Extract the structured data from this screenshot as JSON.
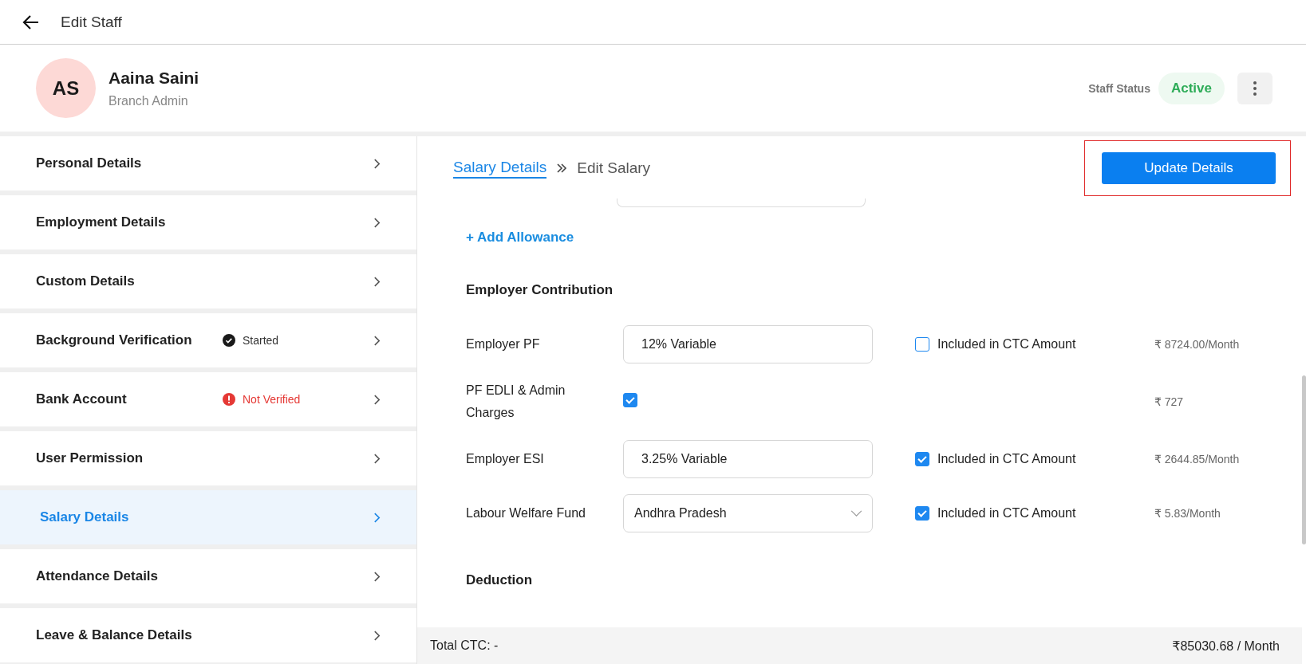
{
  "header": {
    "title": "Edit Staff"
  },
  "profile": {
    "initials": "AS",
    "name": "Aaina Saini",
    "role": "Branch Admin",
    "status_label": "Staff Status",
    "status": "Active"
  },
  "sidebar": {
    "items": [
      {
        "label": "Personal Details",
        "selected": false
      },
      {
        "label": "Employment Details",
        "selected": false
      },
      {
        "label": "Custom Details",
        "selected": false
      },
      {
        "label": "Background Verification",
        "selected": false,
        "badge": {
          "kind": "started",
          "text": "Started"
        }
      },
      {
        "label": "Bank Account",
        "selected": false,
        "badge": {
          "kind": "not_verified",
          "text": "Not Verified"
        }
      },
      {
        "label": "User Permission",
        "selected": false
      },
      {
        "label": "Salary Details",
        "selected": true
      },
      {
        "label": "Attendance Details",
        "selected": false
      },
      {
        "label": "Leave & Balance Details",
        "selected": false
      }
    ]
  },
  "breadcrumb": {
    "link": "Salary Details",
    "current": "Edit Salary"
  },
  "update_button": "Update Details",
  "add_allowance": "+ Add Allowance",
  "employer_contribution": {
    "title": "Employer Contribution",
    "rows": [
      {
        "kind": "input",
        "label": "Employer PF",
        "value": "12% Variable",
        "ctc": {
          "label": "Included in CTC Amount",
          "checked": false
        },
        "amount": "₹ 8724.00/Month"
      },
      {
        "kind": "checkbox",
        "label": "PF EDLI & Admin Charges",
        "checked": true,
        "amount": "₹ 727"
      },
      {
        "kind": "input",
        "label": "Employer ESI",
        "value": "3.25% Variable",
        "ctc": {
          "label": "Included in CTC Amount",
          "checked": true
        },
        "amount": "₹ 2644.85/Month"
      },
      {
        "kind": "select",
        "label": "Labour Welfare Fund",
        "value": "Andhra Pradesh",
        "ctc": {
          "label": "Included in CTC Amount",
          "checked": true
        },
        "amount": "₹ 5.83/Month"
      }
    ]
  },
  "deduction": {
    "title": "Deduction"
  },
  "footer": {
    "total_label": "Total CTC: -",
    "total_value": "₹85030.68 / Month"
  }
}
